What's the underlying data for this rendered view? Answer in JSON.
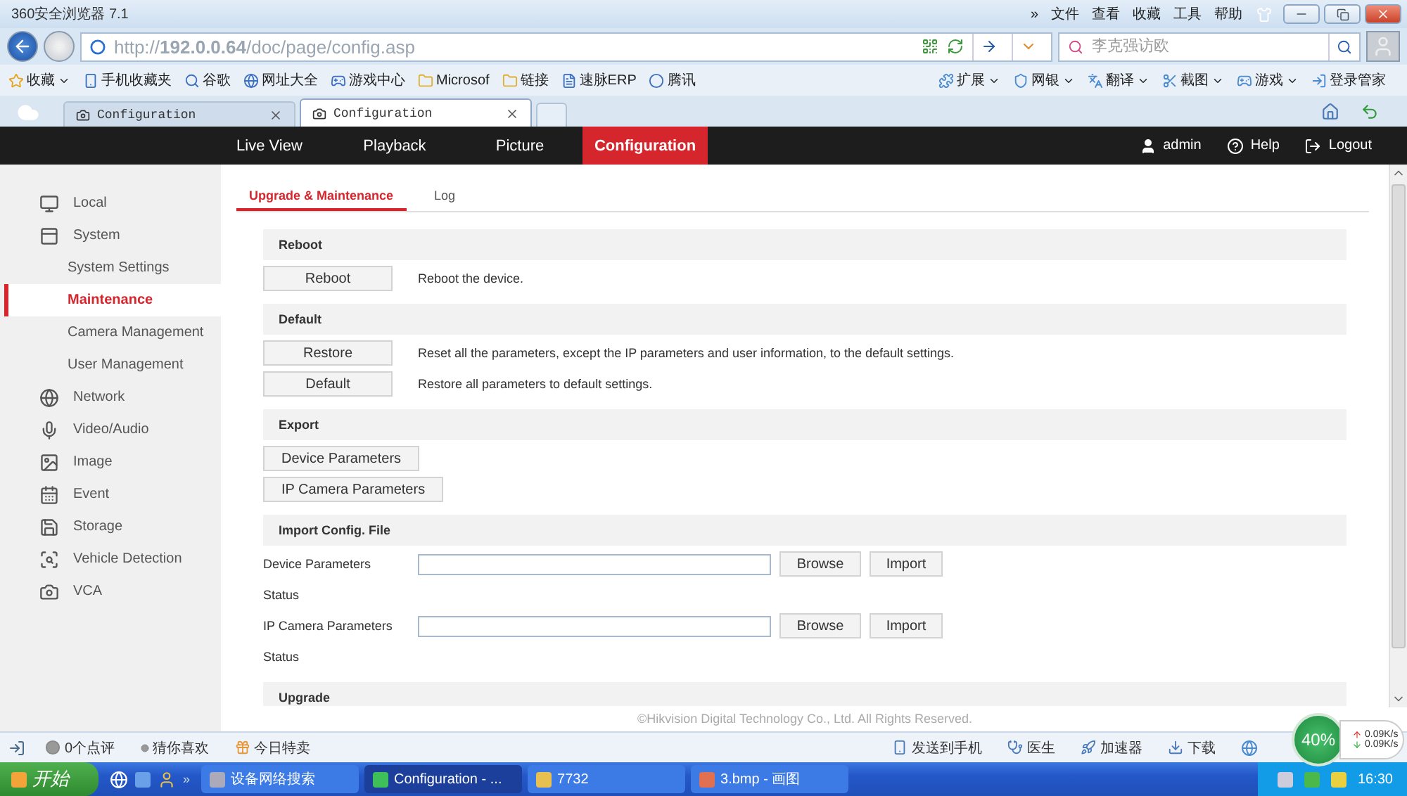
{
  "browser": {
    "title": "360安全浏览器 7.1",
    "menu": [
      "»",
      "文件",
      "查看",
      "收藏",
      "工具",
      "帮助"
    ],
    "address": "http://**192.0.0.64**/doc/page/config.asp",
    "search": {
      "placeholder": "李克强访欧"
    },
    "bookmarks": [
      "收藏",
      "手机收藏夹",
      "谷歌",
      "网址大全",
      "游戏中心",
      "Microsof",
      "链接",
      "速脉ERP",
      "腾讯"
    ],
    "toolbar_items": [
      "扩展",
      "网银",
      "翻译",
      "截图",
      "游戏",
      "登录管家"
    ],
    "tabs": [
      {
        "label": "Configuration",
        "selected": false
      },
      {
        "label": "Configuration",
        "selected": true
      }
    ]
  },
  "app": {
    "nav": [
      {
        "label": "Live View",
        "selected": false
      },
      {
        "label": "Playback",
        "selected": false
      },
      {
        "label": "Picture",
        "selected": false
      },
      {
        "label": "Configuration",
        "selected": true
      }
    ],
    "user": "admin",
    "help": "Help",
    "logout": "Logout",
    "sidebar": [
      {
        "label": "Local",
        "selected": false
      },
      {
        "label": "System",
        "selected": false,
        "children": [
          {
            "label": "System Settings",
            "selected": false
          },
          {
            "label": "Maintenance",
            "selected": true
          },
          {
            "label": "Camera Management",
            "selected": false
          },
          {
            "label": "User Management",
            "selected": false
          }
        ]
      },
      {
        "label": "Network",
        "selected": false
      },
      {
        "label": "Video/Audio",
        "selected": false
      },
      {
        "label": "Image",
        "selected": false
      },
      {
        "label": "Event",
        "selected": false
      },
      {
        "label": "Storage",
        "selected": false
      },
      {
        "label": "Vehicle Detection",
        "selected": false
      },
      {
        "label": "VCA",
        "selected": false
      }
    ],
    "subtabs": [
      {
        "label": "Upgrade & Maintenance",
        "selected": true
      },
      {
        "label": "Log",
        "selected": false
      }
    ],
    "sections": [
      {
        "title": "Reboot",
        "rows": [
          {
            "kind": "action",
            "button": "Reboot",
            "description": "Reboot the device."
          }
        ]
      },
      {
        "title": "Default",
        "rows": [
          {
            "kind": "action",
            "button": "Restore",
            "description": "Reset all the parameters, except the IP parameters and user information, to the default settings."
          },
          {
            "kind": "action",
            "button": "Default",
            "description": "Restore all parameters to default settings."
          }
        ]
      },
      {
        "title": "Export",
        "rows": [
          {
            "kind": "export",
            "button": "Device Parameters"
          },
          {
            "kind": "export",
            "button": "IP Camera Parameters"
          }
        ]
      },
      {
        "title": "Import Config. File",
        "rows": [
          {
            "kind": "file",
            "label": "Device Parameters",
            "buttons": [
              "Browse",
              "Import"
            ]
          },
          {
            "kind": "status",
            "label": "Status"
          },
          {
            "kind": "file",
            "label": "IP Camera Parameters",
            "buttons": [
              "Browse",
              "Import"
            ]
          },
          {
            "kind": "status",
            "label": "Status"
          }
        ]
      },
      {
        "title": "Upgrade"
      }
    ],
    "copyright": "©Hikvision Digital Technology Co., Ltd. All Rights Reserved."
  },
  "status_bar": {
    "left_items": [
      "0个点评",
      "猜你喜欢",
      "今日特卖"
    ],
    "right_items": [
      "发送到手机",
      "医生",
      "加速器",
      "下载"
    ],
    "meter": {
      "reading": "40%",
      "up": "0.09K/s",
      "down": "0.09K/s"
    }
  },
  "taskbar": {
    "start": "开始",
    "more": "»",
    "windows": [
      {
        "label": "设备网络搜索",
        "selected": false
      },
      {
        "label": "Configuration - ...",
        "selected": true
      },
      {
        "label": "7732",
        "selected": false
      },
      {
        "label": "3.bmp - 画图",
        "selected": false
      }
    ],
    "clock": "16:30"
  }
}
